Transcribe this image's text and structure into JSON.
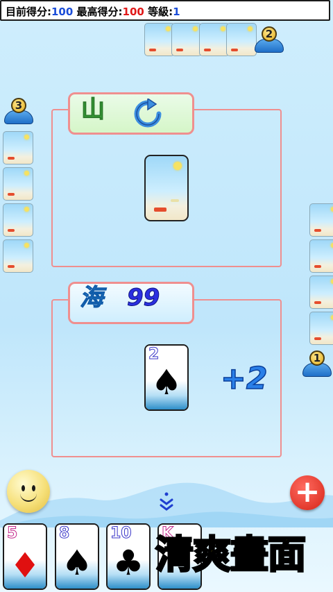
{
  "status": {
    "current_label": "目前得分:",
    "current_value": "100",
    "best_label": "最高得分:",
    "best_value": "100",
    "level_label": "等級:",
    "level_value": "1"
  },
  "players": {
    "top_badge": "2",
    "left_badge": "3",
    "right_badge": "1"
  },
  "mountain_pile": {
    "label": "山"
  },
  "sea_pile": {
    "label": "海",
    "count": "99"
  },
  "played_card": {
    "rank": "2",
    "suit": "♠"
  },
  "bonus_text": "+2",
  "hand": [
    {
      "rank": "5",
      "suit": "♦",
      "color": "red"
    },
    {
      "rank": "8",
      "suit": "♠",
      "color": "black"
    },
    {
      "rank": "10",
      "suit": "♣",
      "color": "black"
    },
    {
      "rank": "K",
      "suit": "",
      "color": "red"
    }
  ],
  "promo_text": "清爽畫面",
  "add_button_label": "+"
}
